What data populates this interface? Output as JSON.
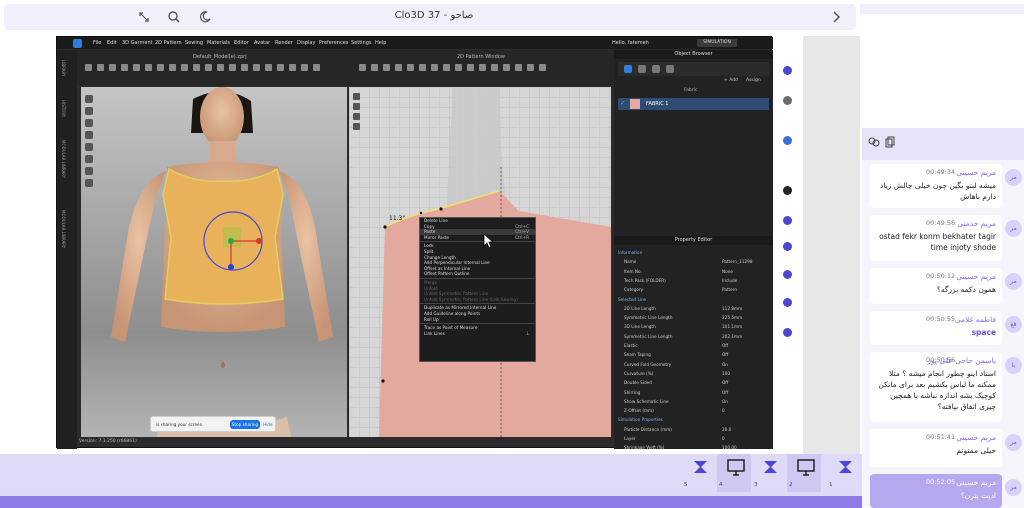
{
  "header": {
    "title": "Clo3D 37 - صاحو",
    "icons": [
      "back-icon",
      "moon-icon",
      "search-icon",
      "fullscreen-icon"
    ]
  },
  "clo": {
    "menu": [
      "File",
      "Edit",
      "3D Garment",
      "2D Pattern",
      "Sewing",
      "Materials",
      "Editor",
      "Avatar",
      "Render",
      "Display",
      "Preferences",
      "Settings",
      "Help"
    ],
    "user": "Hello, fatemeh",
    "simulation_label": "SIMULATION",
    "view3d_title": "Default_Model(e).zprj",
    "view2d_title": "2D Pattern Window",
    "object_browser_title": "Object Browser",
    "property_editor_title": "Property Editor",
    "left_rail_labels": [
      "LIBRARY",
      "HISTORY",
      "MODULAR LIBRARY",
      "MODULAR LIBRARY"
    ],
    "fabric_tab": "Fabric",
    "add_label": "+ Add",
    "assign_label": "Assign",
    "fabric_item": "FABRIC 1",
    "measure_label": "11.3\"",
    "version": "Version: 7.1.250 (r66861)"
  },
  "context_menu": [
    {
      "label": "Delete Line",
      "shortcut": "",
      "state": "normal"
    },
    {
      "label": "Copy",
      "shortcut": "Ctrl+C",
      "state": "normal"
    },
    {
      "label": "Paste",
      "shortcut": "Ctrl+V",
      "state": "highlight"
    },
    {
      "label": "Mirror Paste",
      "shortcut": "Ctrl+R",
      "state": "normal"
    },
    {
      "label": "Lock",
      "shortcut": "",
      "state": "normal"
    },
    {
      "label": "Split",
      "shortcut": "",
      "state": "normal"
    },
    {
      "label": "Change Length",
      "shortcut": "",
      "state": "normal"
    },
    {
      "label": "Add Perpendicular Internal Line",
      "shortcut": "",
      "state": "normal"
    },
    {
      "label": "Offset as Internal Line",
      "shortcut": "",
      "state": "normal"
    },
    {
      "label": "Offset Pattern Outline",
      "shortcut": "",
      "state": "normal"
    },
    {
      "label": "Merge",
      "shortcut": "",
      "state": "disabled"
    },
    {
      "label": "Unfold",
      "shortcut": "",
      "state": "disabled"
    },
    {
      "label": "Unfold Symmetric Pattern Line",
      "shortcut": "",
      "state": "disabled"
    },
    {
      "label": "Unfold Symmetric Pattern Line (Link Sewing)",
      "shortcut": "",
      "state": "disabled"
    },
    {
      "label": "Duplicate as Mirrored Internal Line",
      "shortcut": "",
      "state": "normal"
    },
    {
      "label": "Add Guideline along Points",
      "shortcut": "",
      "state": "normal"
    },
    {
      "label": "Roll Up",
      "shortcut": "",
      "state": "normal"
    },
    {
      "label": "Trace as Point of Measure",
      "shortcut": "",
      "state": "normal"
    },
    {
      "label": "Link Lines",
      "shortcut": "L",
      "state": "normal"
    }
  ],
  "property_editor": [
    {
      "type": "section",
      "label": "Information"
    },
    {
      "type": "row",
      "label": "Name",
      "value": "Pattern_11298"
    },
    {
      "type": "row",
      "label": "Item No.",
      "value": "None"
    },
    {
      "type": "row",
      "label": "Tech Pack (FOLDER)",
      "value": "Include"
    },
    {
      "type": "row",
      "label": "Category",
      "value": "Pattern"
    },
    {
      "type": "section",
      "label": "Selected Line"
    },
    {
      "type": "row",
      "label": "2D Line Length",
      "value": "112.8mm"
    },
    {
      "type": "row",
      "label": "Symmetric Line Length",
      "value": "225.5mm"
    },
    {
      "type": "row",
      "label": "3D Line Length",
      "value": "101.1mm"
    },
    {
      "type": "row",
      "label": "Symmetric Line Length",
      "value": "202.1mm"
    },
    {
      "type": "row",
      "label": "Elastic",
      "value": "Off"
    },
    {
      "type": "row",
      "label": "Seam Taping",
      "value": "Off"
    },
    {
      "type": "row",
      "label": "Curved Fold Geometry",
      "value": "On"
    },
    {
      "type": "row",
      "label": "Curvature (%)",
      "value": "100"
    },
    {
      "type": "row",
      "label": "Double Sided",
      "value": "Off"
    },
    {
      "type": "row",
      "label": "Shirring",
      "value": "Off"
    },
    {
      "type": "row",
      "label": "Show Schematic Line",
      "value": "On"
    },
    {
      "type": "row",
      "label": "Z-Offset (mm)",
      "value": "0"
    },
    {
      "type": "section",
      "label": "Simulation Properties"
    },
    {
      "type": "row",
      "label": "Particle Distance (mm)",
      "value": "20.0"
    },
    {
      "type": "row",
      "label": "Layer",
      "value": "0"
    },
    {
      "type": "row",
      "label": "Shrinkage Weft (%)",
      "value": "100.00"
    }
  ],
  "share_bar": {
    "text": "is sharing your screen.",
    "stop": "Stop sharing",
    "hide": "Hide"
  },
  "chat": {
    "messages": [
      {
        "name": "مریم حسینی",
        "time": "00:49:34",
        "body": "میشه لبتو بگین چون خیلی چالش زیاد دارم باهاش",
        "highlight": false
      },
      {
        "name": "مریم خدمتی",
        "time": "00:49:56",
        "body": "ostad fekr konm bekhater tagir time injoty shode",
        "highlight": false
      },
      {
        "name": "مریم حسینی",
        "time": "00:50:12",
        "body": "همون دکمه بزرگه؟",
        "highlight": false
      },
      {
        "name": "فاطمه غلامی",
        "time": "00:50:55",
        "body": "space",
        "highlight": false
      },
      {
        "name": "یاسمن حاجی علی پور",
        "time": "00:50:56",
        "body": "استاد اینو چطور انجام میشه ؟ مثلا ممکنه ما لباس بکشیم بعد برای مانکن کوچیک بشه اندازه نباشه با همچین چیزی اتفاق بیافته؟",
        "highlight": false
      },
      {
        "name": "مریم حسینی",
        "time": "00:51:41",
        "body": "خیلی ممنونم",
        "highlight": false
      },
      {
        "name": "مریم حسینی",
        "time": "00:52:05",
        "body": "ادیت پترن؟",
        "highlight": true
      }
    ],
    "avatars": [
      "مر",
      "مر",
      "مر",
      "فغ",
      "یا",
      "مر",
      "مر"
    ]
  },
  "tiles": [
    {
      "num": "1",
      "kind": "logo"
    },
    {
      "num": "2",
      "kind": "screen"
    },
    {
      "num": "3",
      "kind": "logo"
    },
    {
      "num": "4",
      "kind": "screen"
    },
    {
      "num": "5",
      "kind": "logo"
    }
  ],
  "colors": {
    "accent": "#8c67e8",
    "brand_blue": "#4b45d8",
    "highlight_msg": "#b6a8ef",
    "garment": "#e9b15a",
    "pattern": "#e3a89e"
  }
}
